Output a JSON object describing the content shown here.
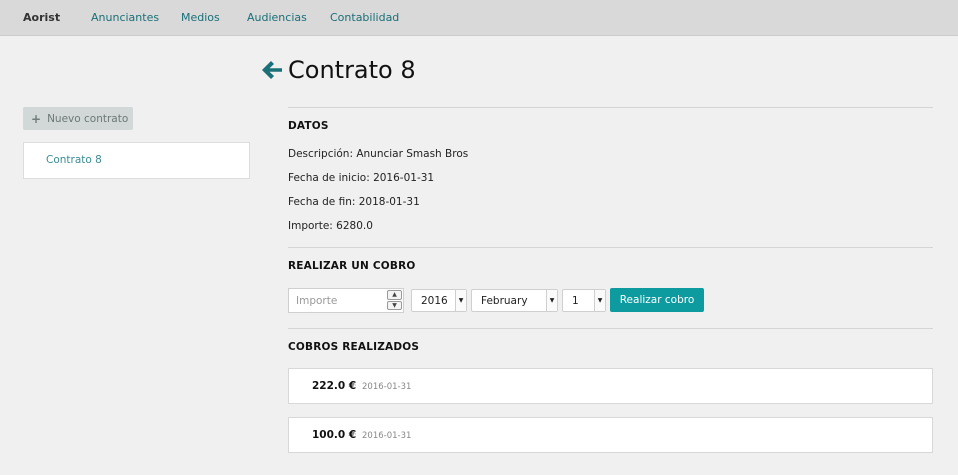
{
  "nav": {
    "brand": "Aorist",
    "links": [
      "Anunciantes",
      "Medios",
      "Audiencias",
      "Contabilidad"
    ]
  },
  "sidebar": {
    "new_button": "Nuevo contrato",
    "items": [
      "Contrato 8"
    ]
  },
  "page": {
    "title": "Contrato 8"
  },
  "datos": {
    "heading": "DATOS",
    "descripcion": "Descripción: Anunciar Smash Bros",
    "fecha_inicio": "Fecha de inicio: 2016-01-31",
    "fecha_fin": "Fecha de fin: 2018-01-31",
    "importe": "Importe: 6280.0"
  },
  "cobro": {
    "heading": "REALIZAR UN COBRO",
    "amount_placeholder": "Importe",
    "year": "2016",
    "month": "February",
    "day": "1",
    "submit": "Realizar cobro"
  },
  "realizados": {
    "heading": "COBROS REALIZADOS",
    "items": [
      {
        "amount": "222.0 €",
        "sep": "·",
        "date": "2016-01-31"
      },
      {
        "amount": "100.0 €",
        "sep": "·",
        "date": "2016-01-31"
      }
    ]
  },
  "colors": {
    "accent": "#0d9ba0",
    "link": "#1a6f78"
  }
}
